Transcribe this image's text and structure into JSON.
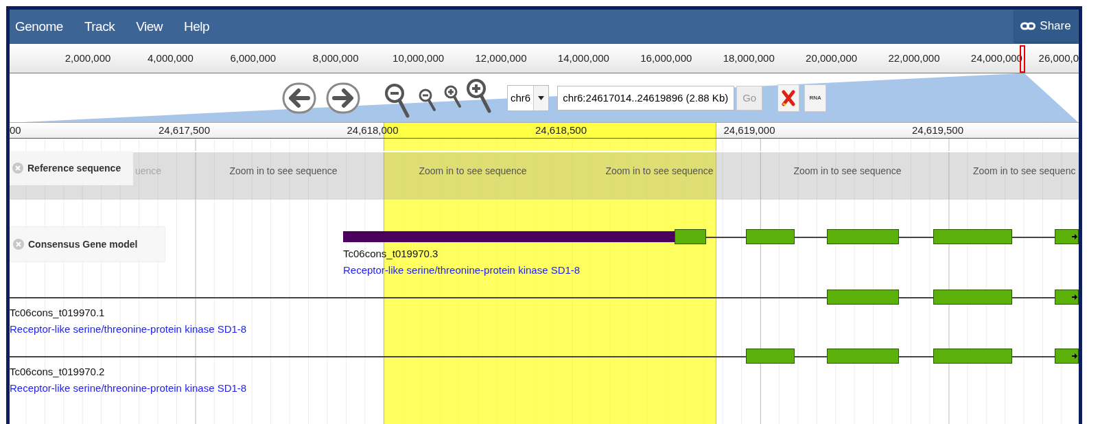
{
  "menu": [
    {
      "label": "Genome"
    },
    {
      "label": "Track"
    },
    {
      "label": "View"
    },
    {
      "label": "Help"
    }
  ],
  "share_button": {
    "label": "Share"
  },
  "overview_ruler": {
    "ticks": [
      "2,000,000",
      "4,000,000",
      "6,000,000",
      "8,000,000",
      "10,000,000",
      "12,000,000",
      "14,000,000",
      "16,000,000",
      "18,000,000",
      "20,000,000",
      "22,000,000",
      "24,000,000",
      "26,000,0"
    ]
  },
  "navigation": {
    "chromosome_select": {
      "value": "chr6"
    },
    "location_field": {
      "value": "chr6:24617014..24619896 (2.88 Kb)"
    },
    "go_button": {
      "label": "Go",
      "disabled": true
    },
    "rna_button": {
      "label": "RNA"
    }
  },
  "detail_ruler": {
    "ticks": [
      "00",
      "24,617,500",
      "24,618,000",
      "24,618,500",
      "24,619,000",
      "24,619,500"
    ]
  },
  "tracks": [
    {
      "kind": "sequence",
      "label": "Reference sequence",
      "messages": [
        "uence",
        "Zoom in to see sequence",
        "Zoom in to see sequence",
        "Zoom in to see sequence",
        "Zoom in to see sequence",
        "Zoom in to see sequenc"
      ]
    },
    {
      "kind": "genes",
      "label": "Consensus Gene model",
      "features": [
        {
          "name": "Tc06cons_t019970.3",
          "description": "Receptor-like serine/threonine-protein kinase SD1-8"
        },
        {
          "name": "Tc06cons_t019970.1",
          "description": "Receptor-like serine/threonine-protein kinase SD1-8"
        },
        {
          "name": "Tc06cons_t019970.2",
          "description": "Receptor-like serine/threonine-protein kinase SD1-8"
        }
      ]
    }
  ]
}
